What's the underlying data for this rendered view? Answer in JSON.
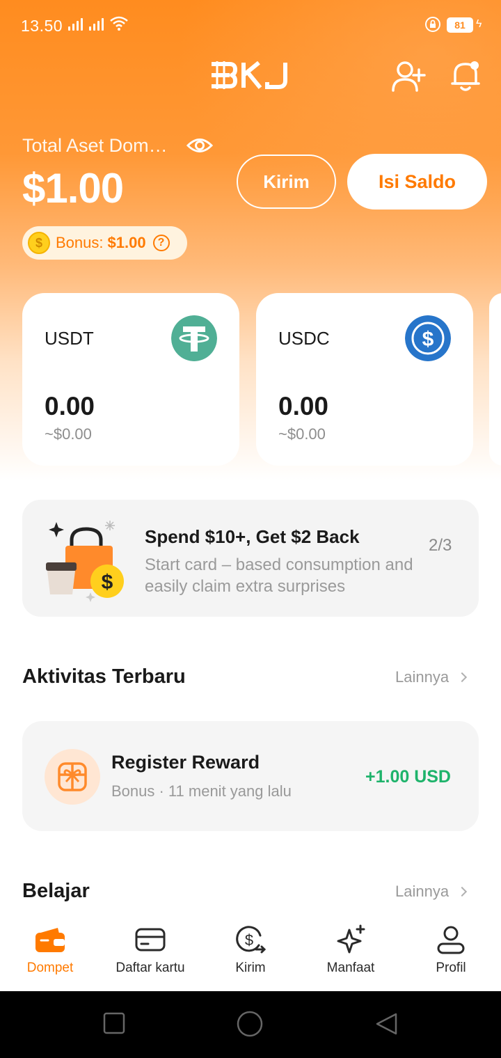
{
  "status_bar": {
    "time": "13.50",
    "battery": "81"
  },
  "header": {
    "logo_text": "BKJ"
  },
  "wallet": {
    "total_label": "Total Aset Dompet",
    "total_value": "$1.00",
    "send_label": "Kirim",
    "topup_label": "Isi Saldo",
    "bonus_label": "Bonus:",
    "bonus_value": "$1.00"
  },
  "tokens": [
    {
      "symbol": "USDT",
      "amount": "0.00",
      "fiat": "~$0.00",
      "color": "#50af95"
    },
    {
      "symbol": "USDC",
      "amount": "0.00",
      "fiat": "~$0.00",
      "color": "#2775ca"
    }
  ],
  "promo": {
    "title": "Spend $10+, Get $2 Back",
    "description": "Start card – based consumption and easily claim extra surprises",
    "page": "2/3"
  },
  "activity": {
    "title": "Aktivitas Terbaru",
    "more": "Lainnya",
    "items": [
      {
        "title": "Register Reward",
        "subtitle": "Bonus · 11 menit yang lalu",
        "amount": "+1.00 USD"
      }
    ]
  },
  "learn": {
    "title": "Belajar",
    "more": "Lainnya"
  },
  "nav": {
    "items": [
      {
        "label": "Dompet",
        "icon": "wallet-icon",
        "active": true
      },
      {
        "label": "Daftar kartu",
        "icon": "card-icon"
      },
      {
        "label": "Kirim",
        "icon": "send-money-icon"
      },
      {
        "label": "Manfaat",
        "icon": "sparkle-icon"
      },
      {
        "label": "Profil",
        "icon": "profile-icon"
      }
    ]
  },
  "colors": {
    "brand": "#ff8c1f",
    "accent": "#ff7a00",
    "positive": "#1eb36b"
  }
}
